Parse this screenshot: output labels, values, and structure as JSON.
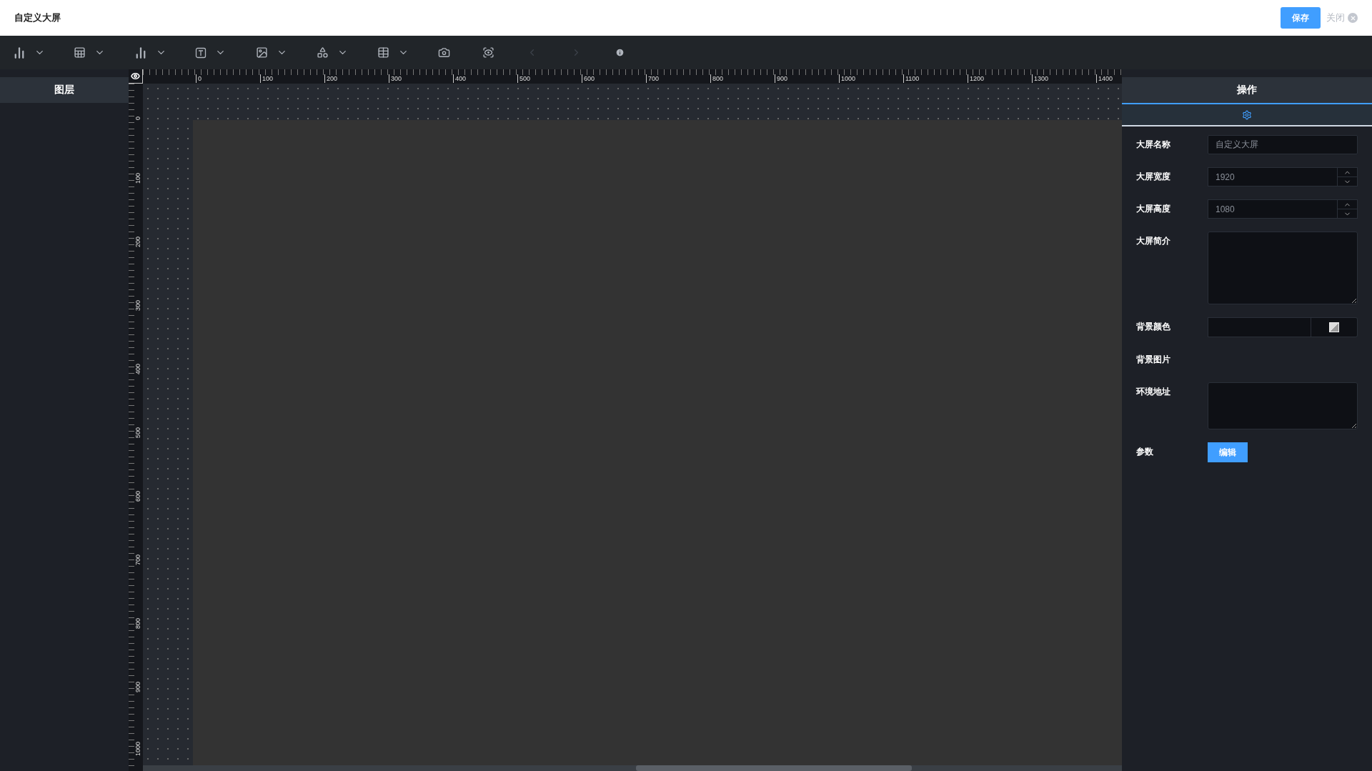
{
  "header": {
    "title": "自定义大屏",
    "save_button": "保存",
    "close_link": "关闭"
  },
  "toolbar": [
    {
      "dropdown": true,
      "disabled": false
    },
    {
      "dropdown": true,
      "disabled": false
    },
    {
      "dropdown": true,
      "disabled": false
    },
    {
      "dropdown": true,
      "disabled": false
    },
    {
      "dropdown": true,
      "disabled": false
    },
    {
      "dropdown": true,
      "disabled": false
    },
    {
      "dropdown": true,
      "disabled": false
    },
    {
      "dropdown": false,
      "disabled": false
    },
    {
      "dropdown": false,
      "disabled": false
    },
    {
      "dropdown": false,
      "disabled": true
    },
    {
      "dropdown": false,
      "disabled": true
    },
    {
      "dropdown": false,
      "disabled": false
    }
  ],
  "layers_panel": {
    "title": "图层"
  },
  "rulers": {
    "horizontal": [
      "0",
      "100",
      "200",
      "300",
      "400",
      "500",
      "600",
      "700",
      "800",
      "900",
      "1000",
      "1100",
      "1200",
      "1300",
      "1400"
    ],
    "vertical": [
      "0",
      "100",
      "200",
      "300",
      "400",
      "500",
      "600",
      "700",
      "800",
      "900",
      "1000"
    ]
  },
  "settings_panel": {
    "title": "操作",
    "tabs": [
      {
        "selected": true
      }
    ],
    "fields": [
      {
        "kind": "text",
        "label": "大屏名称",
        "value": "自定义大屏"
      },
      {
        "kind": "number",
        "label": "大屏宽度",
        "value": "1920"
      },
      {
        "kind": "number",
        "label": "大屏高度",
        "value": "1080"
      },
      {
        "kind": "textarea",
        "label": "大屏简介"
      },
      {
        "kind": "color",
        "label": "背景颜色"
      },
      {
        "kind": "label",
        "label": "背景图片"
      },
      {
        "kind": "shortarea",
        "label": "环境地址"
      },
      {
        "kind": "button",
        "label": "参数",
        "button": "编辑"
      }
    ]
  }
}
